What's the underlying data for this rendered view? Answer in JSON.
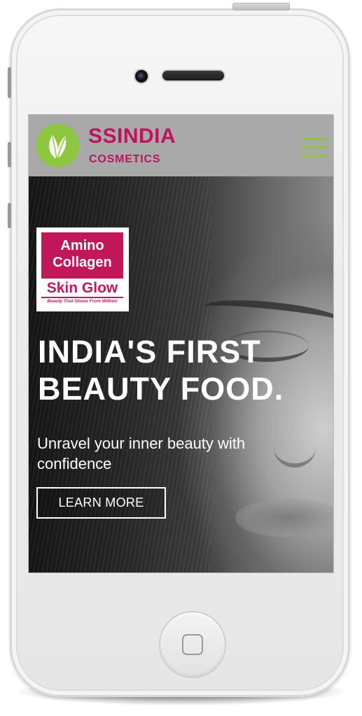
{
  "brand": {
    "name": "SSINDIA",
    "tagline": "COSMETICS",
    "colors": {
      "brand_pink": "#c0135d",
      "leaf_green": "#8dc63f",
      "header_bg": "#a9a9a9"
    }
  },
  "nav": {
    "menu_icon": "hamburger-menu-icon"
  },
  "product": {
    "line1": "Amino",
    "line2": "Collagen",
    "line3": "Skin Glow",
    "tagline": "Beauty That Glows From Within!"
  },
  "hero": {
    "headline_line1": "INDIA'S FIRST",
    "headline_line2": "BEAUTY FOOD.",
    "subtitle_line1": "Unravel your inner beauty with",
    "subtitle_line2": "confidence",
    "cta_label": "LEARN MORE"
  },
  "device": {
    "type": "phone-mockup",
    "home_icon": "home-button-icon"
  }
}
